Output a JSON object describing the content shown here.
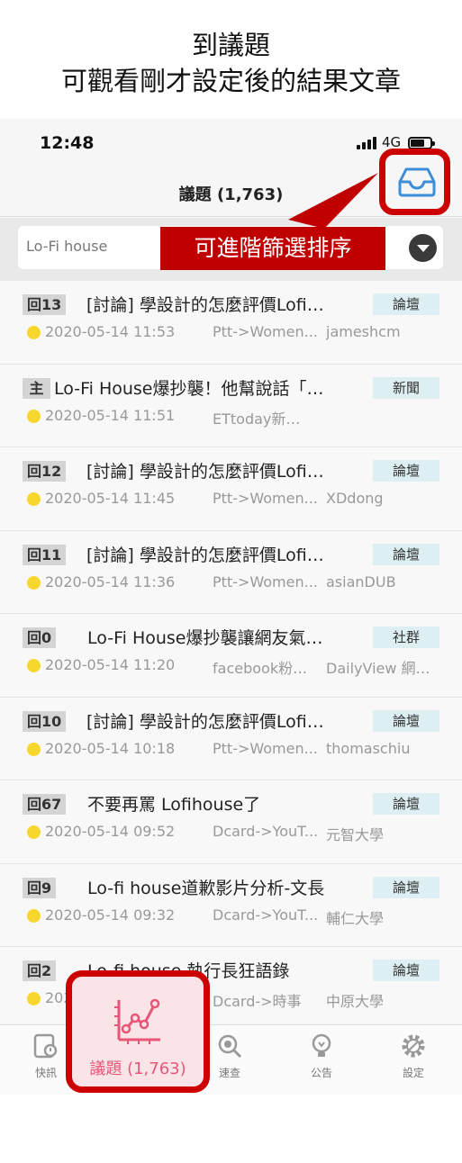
{
  "caption": {
    "line1": "到議題",
    "line2": "可觀看剛才設定後的結果文章"
  },
  "status_bar": {
    "time": "12:48",
    "network": "4G"
  },
  "nav": {
    "title": "議題 (1,763)",
    "inbox_icon": "inbox-tray-icon"
  },
  "search": {
    "value": "Lo-Fi house"
  },
  "callout": {
    "text": "可進階篩選排序"
  },
  "list": [
    {
      "badge": "回13",
      "title": "[討論] 學設計的怎麼評價Lofi…",
      "tag": "論壇",
      "date": "2020-05-14 11:53",
      "source": "Ptt->Women...",
      "author": "jameshcm"
    },
    {
      "badge": "主",
      "title": "Lo-Fi House爆抄襲！他幫說話「…",
      "tag": "新聞",
      "date": "2020-05-14 11:51",
      "source": "ETtoday新…",
      "author": ""
    },
    {
      "badge": "回12",
      "title": "[討論] 學設計的怎麼評價Lofi…",
      "tag": "論壇",
      "date": "2020-05-14 11:45",
      "source": "Ptt->Women...",
      "author": "XDdong"
    },
    {
      "badge": "回11",
      "title": "[討論] 學設計的怎麼評價Lofi…",
      "tag": "論壇",
      "date": "2020-05-14 11:36",
      "source": "Ptt->Women...",
      "author": "asianDUB"
    },
    {
      "badge": "回0",
      "title": "Lo-Fi House爆抄襲讓網友氣…",
      "tag": "社群",
      "date": "2020-05-14 11:20",
      "source": "facebook粉…",
      "author": "DailyView 網…"
    },
    {
      "badge": "回10",
      "title": "[討論] 學設計的怎麼評價Lofi…",
      "tag": "論壇",
      "date": "2020-05-14 10:18",
      "source": "Ptt->Women...",
      "author": "thomaschiu"
    },
    {
      "badge": "回67",
      "title": "不要再罵 Lofihouse了",
      "tag": "論壇",
      "date": "2020-05-14 09:52",
      "source": "Dcard->YouT...",
      "author": "元智大學"
    },
    {
      "badge": "回9",
      "title": "Lo-fi house道歉影片分析-文長",
      "tag": "論壇",
      "date": "2020-05-14 09:32",
      "source": "Dcard->YouT...",
      "author": "輔仁大學"
    },
    {
      "badge": "回2",
      "title": "Lo-fi house 執行長狂語錄",
      "tag": "論壇",
      "date": "2020-05-14",
      "source": "Dcard->時事",
      "author": "中原大學"
    }
  ],
  "tabs": [
    {
      "label": "快訊",
      "icon": "news-tablet-icon"
    },
    {
      "label": "議題 (1,763)",
      "icon": "line-chart-icon"
    },
    {
      "label": "速查",
      "icon": "magnifier-icon"
    },
    {
      "label": "公告",
      "icon": "lightbulb-icon"
    },
    {
      "label": "設定",
      "icon": "gear-icon"
    }
  ],
  "colors": {
    "highlight_red": "#cc0000",
    "active_tab_text": "#e85577",
    "tag_bg": "#ddeff2",
    "dot_yellow": "#f7d72e",
    "inbox_blue": "#3b8fd8"
  }
}
